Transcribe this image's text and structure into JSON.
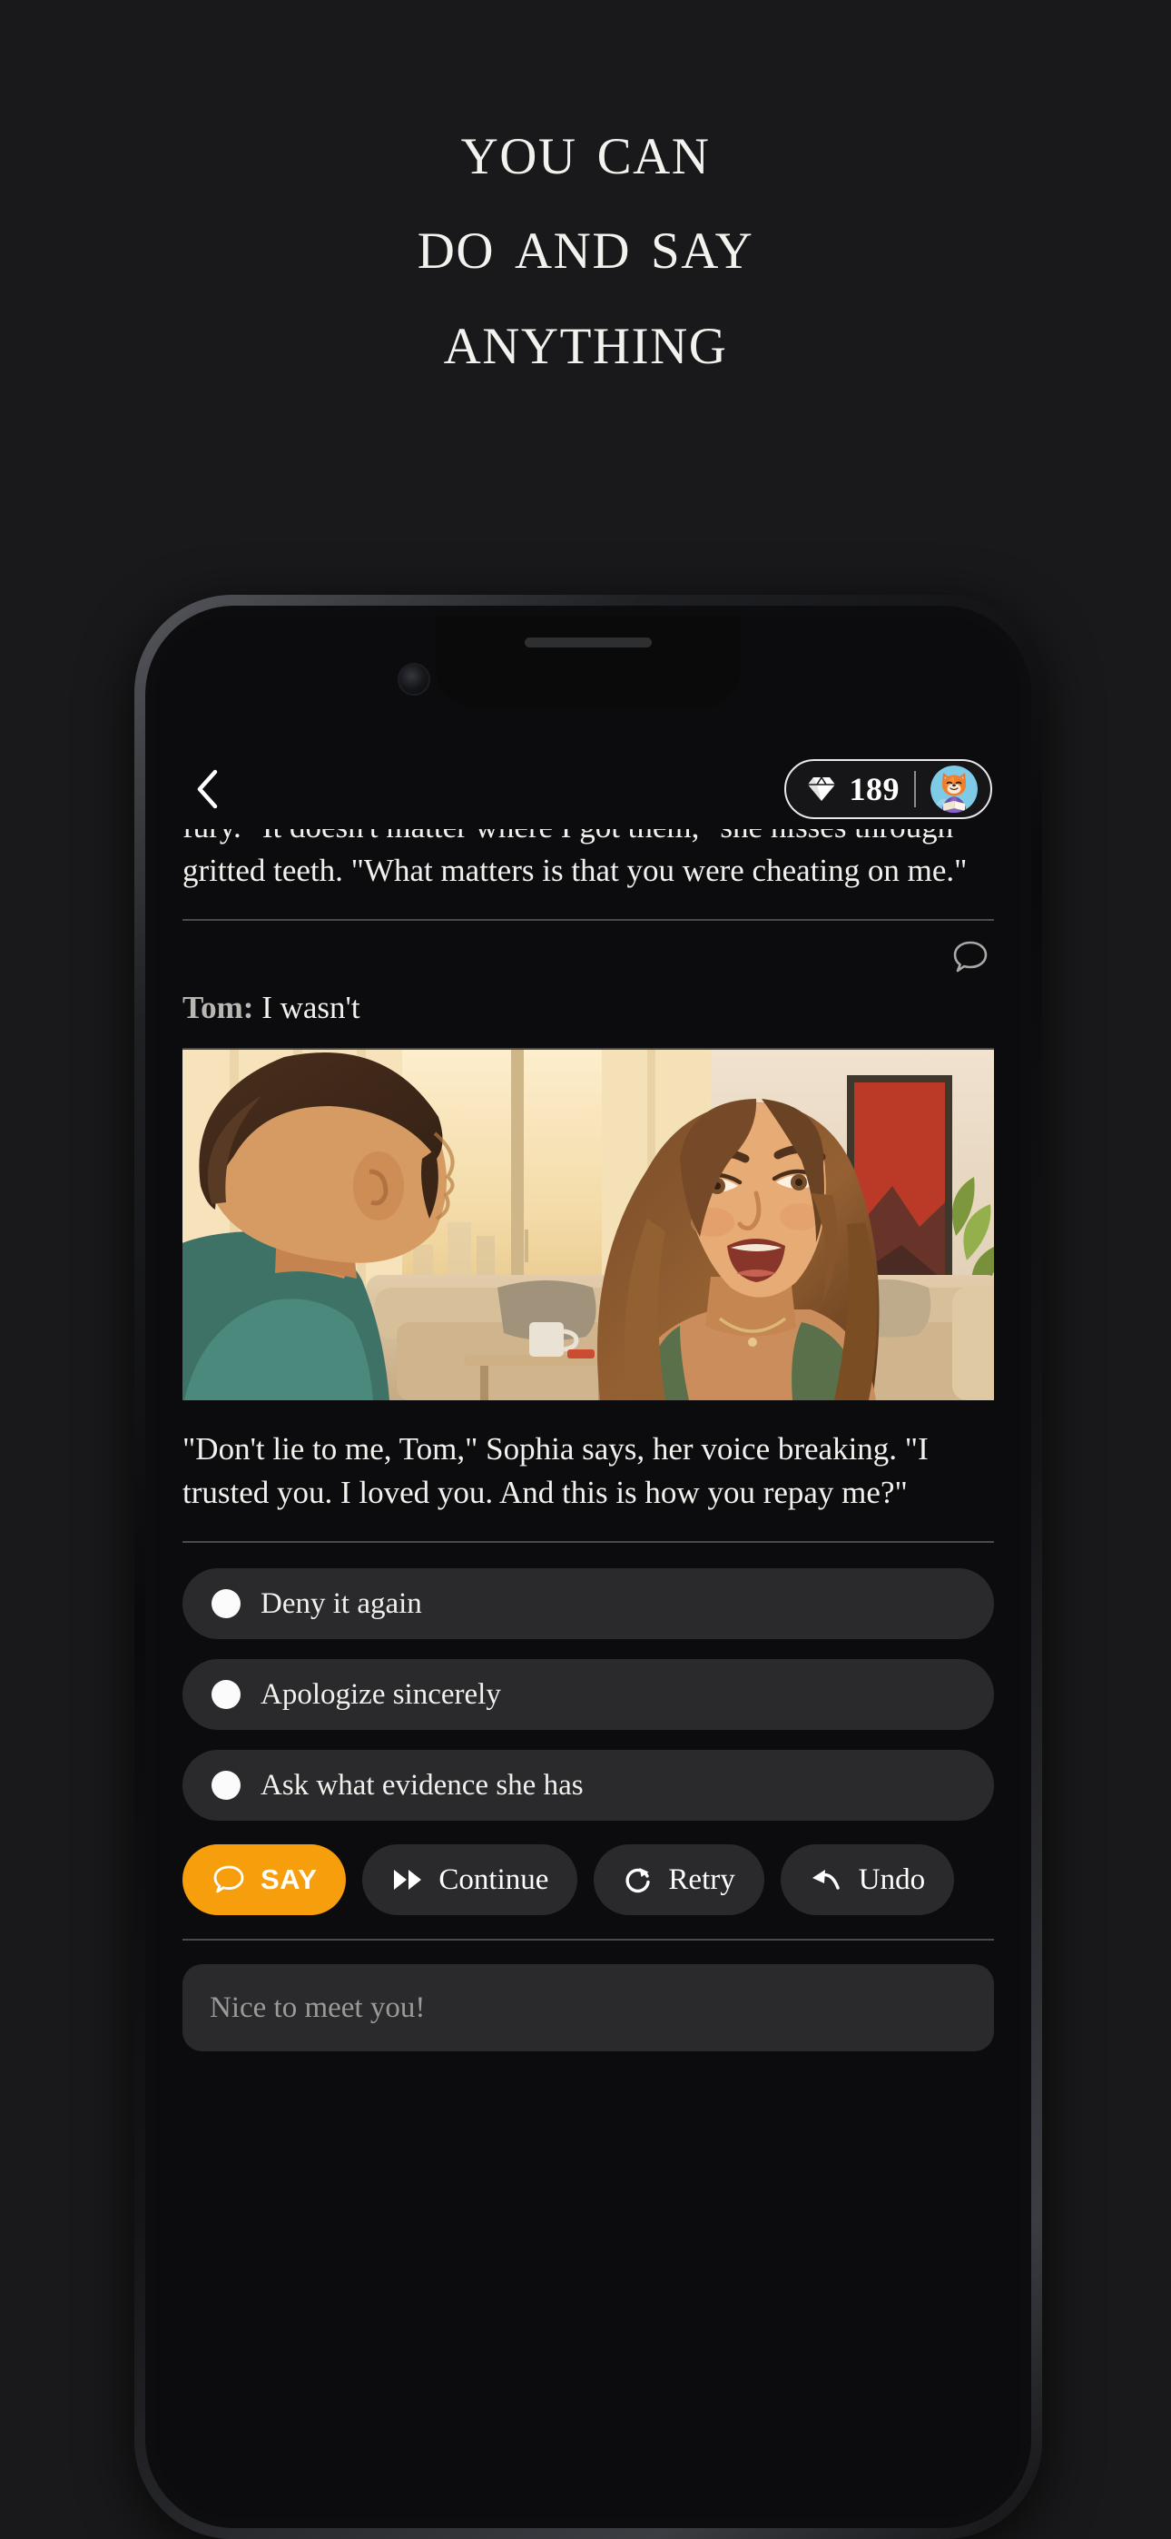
{
  "headline": {
    "lines": [
      "You can",
      "Do and Say",
      "Anything"
    ]
  },
  "phone": {
    "header": {
      "back_icon": "chevron-left-icon",
      "gem_icon": "diamond-icon",
      "gem_count": "189",
      "avatar_icon": "fox-reading-avatar"
    },
    "story": {
      "previous_paragraph": "fury. \"It doesn't matter where I got them,\" she hisses through gritted teeth. \"What matters is that you were cheating on me.\"",
      "user_turn": {
        "speaker": "Tom:",
        "text": "I wasn't",
        "bubble_icon": "speech-bubble-icon"
      },
      "scene_alt": "Illustrated living-room scene: man with dark hair in teal shirt seen from behind faces an upset woman with long brown hair.",
      "current_paragraph": "\"Don't lie to me, Tom,\" Sophia says, her voice breaking. \"I trusted you. I loved you. And this is how you repay me?\""
    },
    "choices": [
      {
        "label": "Deny it again"
      },
      {
        "label": "Apologize sincerely"
      },
      {
        "label": "Ask what evidence she has"
      }
    ],
    "actions": [
      {
        "label": "SAY",
        "icon": "speech-bubble-icon",
        "primary": true
      },
      {
        "label": "Continue",
        "icon": "fast-forward-icon",
        "primary": false
      },
      {
        "label": "Retry",
        "icon": "refresh-icon",
        "primary": false
      },
      {
        "label": "Undo",
        "icon": "undo-arrow-icon",
        "primary": false
      }
    ],
    "composer": {
      "placeholder": "Nice to meet you!",
      "value": ""
    }
  },
  "colors": {
    "page_background": "#19191b",
    "accent_orange": "#f79e0c",
    "pill_background": "#2a2a2c",
    "text_primary": "#f3f1ee",
    "text_muted": "#9b9a99"
  }
}
